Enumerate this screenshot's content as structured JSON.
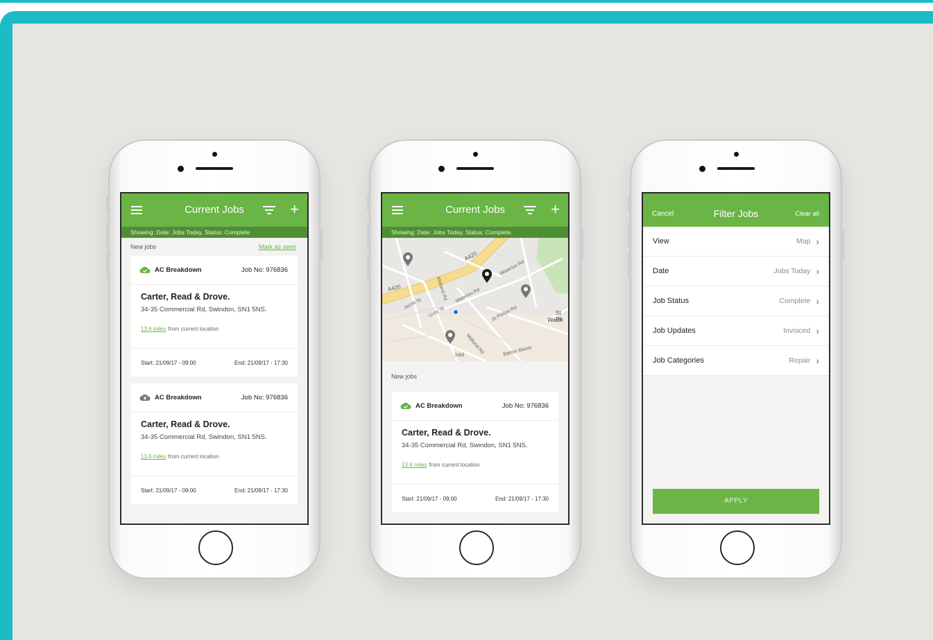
{
  "colors": {
    "accent": "#6ab545",
    "accent_dark": "#4f8f33",
    "frame": "#1bbcc6",
    "background": "#e6e5e1"
  },
  "phone1": {
    "title": "Current Jobs",
    "showing": "Showing: Date: Jobs Today, Status: Complete",
    "section_label": "New jobs",
    "mark_seen": "Mark as seen",
    "jobs": [
      {
        "category": "AC Breakdown",
        "job_no": "Job No: 976836",
        "company": "Carter, Read & Drove.",
        "address": "34-35 Commercial Rd, Swindon, SN1 5NS.",
        "distance": "13.6 miles",
        "distance_suffix": "from current location",
        "start": "Start: 21/09/17 - 09:00",
        "end": "End: 21/09/17 - 17:30"
      },
      {
        "category": "AC Breakdown",
        "job_no": "Job No: 976836",
        "company": "Carter, Read & Drove.",
        "address": "34-35 Commercial Rd, Swindon, SN1 5NS.",
        "distance": "13.6 miles",
        "distance_suffix": "from current location",
        "start": "Start: 21/09/17 - 09:00",
        "end": "End: 21/09/17 - 17:30"
      }
    ]
  },
  "phone2": {
    "title": "Current Jobs",
    "showing": "Showing: Date: Jobs Today, Status: Complete.",
    "map_labels": {
      "a420_top": "A420",
      "a420_left": "A420",
      "waterloo_rd": "Waterloo Rd",
      "waterloo_rd2": "Waterloo Rd",
      "unity_st": "Unity St",
      "jacob_st": "Jacob St",
      "midland_rd": "Midland Rd",
      "midland_rd2": "Midland Rd",
      "st_philips_rd": "St Philips Rd",
      "barton_manor": "Barton Manor",
      "st_philips_waste": "St Ph",
      "waste": "Waste",
      "gloucester": "Jubil"
    },
    "section_label": "New jobs",
    "job": {
      "category": "AC Breakdown",
      "job_no": "Job No: 976836",
      "company": "Carter, Read & Drove.",
      "address": "34-35 Commercial Rd, Swindon, SN1 5NS.",
      "distance": "13.6 miles",
      "distance_suffix": "from current location",
      "start": "Start: 21/09/17 - 09:00",
      "end": "End: 21/09/17 - 17:30"
    }
  },
  "phone3": {
    "cancel": "Cancel",
    "title": "Filter Jobs",
    "clear_all": "Clear all",
    "rows": [
      {
        "label": "View",
        "value": "Map"
      },
      {
        "label": "Date",
        "value": "Jobs Today"
      },
      {
        "label": "Job Status",
        "value": "Complete"
      },
      {
        "label": "Job Updates",
        "value": "Invoiced"
      },
      {
        "label": "Job Categories",
        "value": "Repair"
      }
    ],
    "apply": "APPLY"
  }
}
